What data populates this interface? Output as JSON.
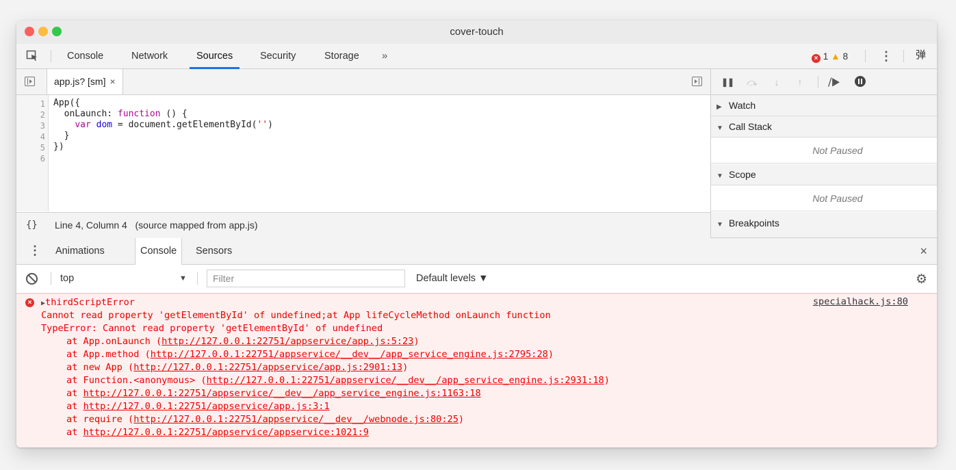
{
  "window": {
    "title": "cover-touch"
  },
  "main_tabs": {
    "tabs": [
      "Console",
      "Network",
      "Sources",
      "Security",
      "Storage"
    ],
    "active": "Sources",
    "more": "»",
    "error_count": "1",
    "warning_count": "8",
    "dock_label": "弹"
  },
  "editor": {
    "file_tab": "app.js? [sm]",
    "file_tab_close": "×",
    "line_numbers": [
      "1",
      "2",
      "3",
      "4",
      "5",
      "6"
    ],
    "lines": {
      "l1": "App({",
      "l2_prop": "  onLaunch: ",
      "l2_kw": "function",
      "l2_rest": " () {",
      "l3_indent": "    ",
      "l3_kw": "var",
      "l3_var": " dom",
      "l3_mid": " = document.getElementById(",
      "l3_str": "''",
      "l3_end": ")",
      "l4": "  }",
      "l5": "})"
    },
    "status": {
      "pretty_print": "{}",
      "position": "Line 4, Column 4",
      "source_map": "(source mapped from app.js)"
    }
  },
  "debugger": {
    "sections": {
      "watch": "Watch",
      "call_stack": "Call Stack",
      "call_stack_state": "Not Paused",
      "scope": "Scope",
      "scope_state": "Not Paused",
      "breakpoints": "Breakpoints"
    }
  },
  "drawer": {
    "tabs": [
      "Animations",
      "Console",
      "Sensors"
    ],
    "active": "Console",
    "close": "×"
  },
  "console_toolbar": {
    "context": "top",
    "filter_placeholder": "Filter",
    "levels": "Default levels ▼"
  },
  "console_output": {
    "error_title": "thirdScriptError",
    "source_link": "specialhack.js:80",
    "message": "Cannot read property 'getElementById' of undefined;at App lifeCycleMethod onLaunch function",
    "type_error": "TypeError: Cannot read property 'getElementById' of undefined",
    "frames": [
      {
        "prefix": "at App.onLaunch (",
        "url": "http://127.0.0.1:22751/appservice/app.js:5:23",
        "suffix": ")"
      },
      {
        "prefix": "at App.method (",
        "url": "http://127.0.0.1:22751/appservice/__dev__/app_service_engine.js:2795:28",
        "suffix": ")"
      },
      {
        "prefix": "at new App (",
        "url": "http://127.0.0.1:22751/appservice/app.js:2901:13",
        "suffix": ")"
      },
      {
        "prefix": "at Function.<anonymous> (",
        "url": "http://127.0.0.1:22751/appservice/__dev__/app_service_engine.js:2931:18",
        "suffix": ")"
      },
      {
        "prefix": "at ",
        "url": "http://127.0.0.1:22751/appservice/__dev__/app_service_engine.js:1163:18",
        "suffix": ""
      },
      {
        "prefix": "at ",
        "url": "http://127.0.0.1:22751/appservice/app.js:3:1",
        "suffix": ""
      },
      {
        "prefix": "at require (",
        "url": "http://127.0.0.1:22751/appservice/__dev__/webnode.js:80:25",
        "suffix": ")"
      },
      {
        "prefix": "at ",
        "url": "http://127.0.0.1:22751/appservice/appservice:1021:9",
        "suffix": ""
      }
    ]
  },
  "colors": {
    "accent": "#1a73e8",
    "error_red": "#e00000",
    "error_bg": "#fff0f0",
    "keyword": "#aa0d91",
    "string": "#c41a16"
  },
  "icons": {
    "inspect": "inspect-element-icon",
    "pause": "pause-icon",
    "step_over": "step-over-icon",
    "step_into": "step-into-icon",
    "step_out": "step-out-icon",
    "deactivate": "deactivate-breakpoints-icon",
    "pause_exceptions": "pause-on-exceptions-icon",
    "clear": "clear-console-icon",
    "settings": "gear-icon"
  }
}
